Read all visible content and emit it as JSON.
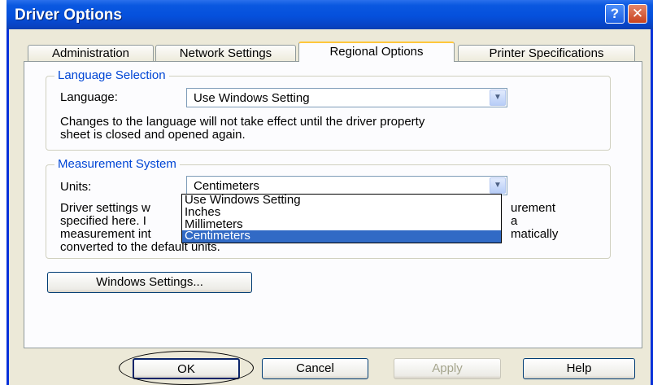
{
  "window": {
    "title": "Driver Options"
  },
  "titlebar_buttons": {
    "help": "?",
    "close": "✕"
  },
  "tabs": [
    {
      "label": "Administration"
    },
    {
      "label": "Network Settings"
    },
    {
      "label": "Regional Options"
    },
    {
      "label": "Printer Specifications"
    }
  ],
  "language_group": {
    "legend": "Language Selection",
    "label": "Language:",
    "value": "Use Windows Setting",
    "note_line1": "Changes to the language will not take effect until the driver property",
    "note_line2": "sheet is closed and opened again."
  },
  "measurement_group": {
    "legend": "Measurement System",
    "label": "Units:",
    "value": "Centimeters",
    "note_line1": "Driver settings w",
    "note_line1_end": "urement",
    "note_line2": "specified here.  I",
    "note_line2_end": "a",
    "note_line3": "measurement int",
    "note_line3_end": "matically",
    "note_line4": "converted to the default units.",
    "options": [
      "Use Windows Setting",
      "Inches",
      "Millimeters",
      "Centimeters"
    ],
    "selected_index": 3
  },
  "windows_settings_button": "Windows Settings...",
  "footer": {
    "ok": "OK",
    "cancel": "Cancel",
    "apply": "Apply",
    "help": "Help"
  },
  "colors": {
    "title_bar": "#0550dc",
    "selection": "#316ac5",
    "legend": "#0046d5"
  }
}
